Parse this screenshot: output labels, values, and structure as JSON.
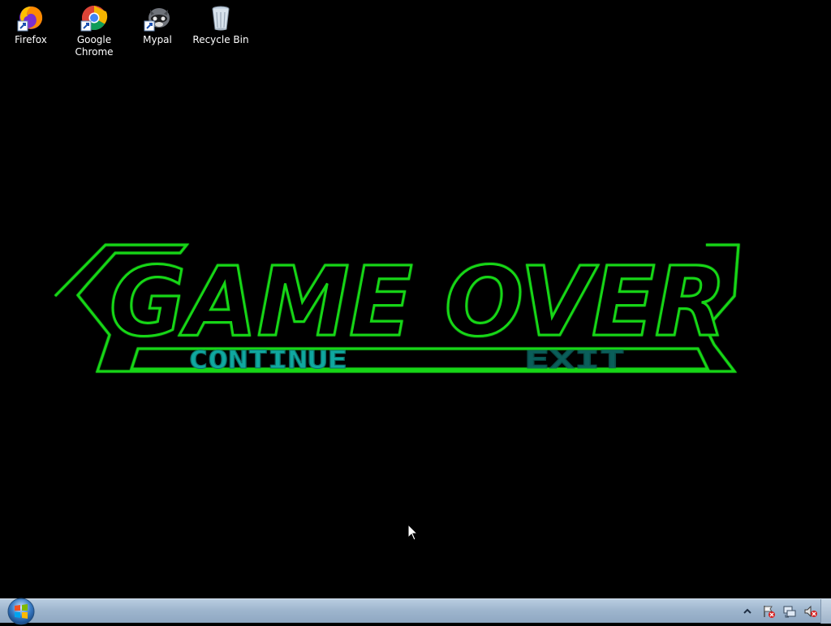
{
  "desktop": {
    "icons": [
      {
        "label": "Firefox",
        "icon": "firefox-icon"
      },
      {
        "label": "Google\nChrome",
        "icon": "chrome-icon"
      },
      {
        "label": "Mypal",
        "icon": "mypal-icon"
      },
      {
        "label": "Recycle Bin",
        "icon": "recycle-bin-icon"
      }
    ]
  },
  "game": {
    "logo_text": "GAME OVER",
    "options": {
      "continue": "CONTINUE",
      "exit": "EXIT"
    },
    "colors": {
      "outline": "#16d616",
      "outline_dark": "#0b7a0b",
      "option_text": "#0fa8a0"
    }
  },
  "taskbar": {
    "start_icon": "windows-start-orb-icon",
    "tray_icons": [
      "show-hidden-icons-chevron-icon",
      "action-center-flag-icon",
      "network-icon",
      "volume-muted-icon"
    ]
  }
}
